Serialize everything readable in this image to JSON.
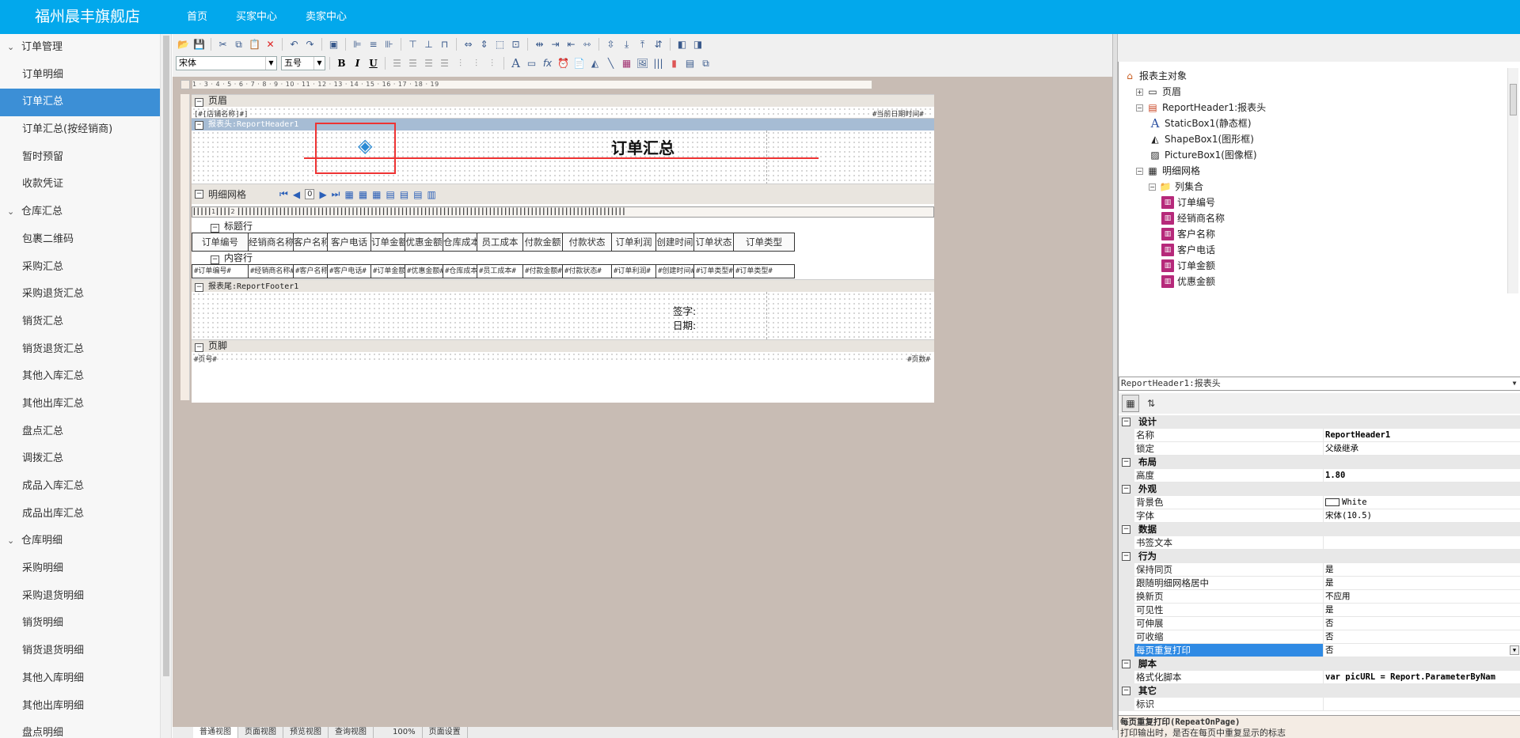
{
  "app": {
    "brand": "福州晨丰旗舰店",
    "nav": [
      "首页",
      "买家中心",
      "卖家中心"
    ]
  },
  "sidebar": [
    {
      "label": "订单管理",
      "type": "group"
    },
    {
      "label": "订单明细",
      "type": "sub"
    },
    {
      "label": "订单汇总",
      "type": "sub",
      "active": true
    },
    {
      "label": "订单汇总(按经销商)",
      "type": "sub"
    },
    {
      "label": "暂时预留",
      "type": "sub"
    },
    {
      "label": "收款凭证",
      "type": "sub"
    },
    {
      "label": "仓库汇总",
      "type": "group"
    },
    {
      "label": "包裹二维码",
      "type": "sub"
    },
    {
      "label": "采购汇总",
      "type": "sub"
    },
    {
      "label": "采购退货汇总",
      "type": "sub"
    },
    {
      "label": "销货汇总",
      "type": "sub"
    },
    {
      "label": "销货退货汇总",
      "type": "sub"
    },
    {
      "label": "其他入库汇总",
      "type": "sub"
    },
    {
      "label": "其他出库汇总",
      "type": "sub"
    },
    {
      "label": "盘点汇总",
      "type": "sub"
    },
    {
      "label": "调拨汇总",
      "type": "sub"
    },
    {
      "label": "成品入库汇总",
      "type": "sub"
    },
    {
      "label": "成品出库汇总",
      "type": "sub"
    },
    {
      "label": "仓库明细",
      "type": "group"
    },
    {
      "label": "采购明细",
      "type": "sub"
    },
    {
      "label": "采购退货明细",
      "type": "sub"
    },
    {
      "label": "销货明细",
      "type": "sub"
    },
    {
      "label": "销货退货明细",
      "type": "sub"
    },
    {
      "label": "其他入库明细",
      "type": "sub"
    },
    {
      "label": "其他出库明细",
      "type": "sub"
    },
    {
      "label": "盘点明细",
      "type": "sub"
    }
  ],
  "toolbar": {
    "font_name": "宋体",
    "font_size": "五号",
    "bold": "B",
    "italic": "I",
    "underline": "U"
  },
  "ruler_text": "1 · 3 · 4 · 5 · 6 · 7 · 8 · 9 · 10 · 11 · 12 · 13 · 14 · 15 · 16 · 17 · 18 · 19",
  "report": {
    "page_header": {
      "label": "页眉",
      "left_field": "[#[店铺名称]#]",
      "right_field": "#当前日期时间#"
    },
    "report_header": {
      "label": "报表头:ReportHeader1",
      "title": "订单汇总"
    },
    "detail_grid": {
      "label": "明细网格",
      "page_box": "0"
    },
    "title_row": {
      "label": "标题行"
    },
    "columns": [
      "订单编号",
      "经销商名称",
      "客户名称",
      "客户电话",
      "订单金额",
      "优惠金额",
      "仓库成本",
      "员工成本",
      "付款金额",
      "付款状态",
      "订单利润",
      "创建时间",
      "订单状态",
      "订单类型"
    ],
    "content_row": {
      "label": "内容行"
    },
    "cells": [
      "#订单编号#",
      "#经销商名称#",
      "#客户名称#",
      "#客户电话#",
      "#订单金额#",
      "#优惠金额#",
      "#仓库成本#",
      "#员工成本#",
      "#付款金额#",
      "#付款状态#",
      "#订单利润#",
      "#创建时间#",
      "#订单类型#",
      "#订单类型#"
    ],
    "report_footer": {
      "label": "报表尾:ReportFooter1",
      "sign": "签字:",
      "date": "日期:"
    },
    "page_footer": {
      "label": "页脚",
      "left_field": "#页号#",
      "right_field": "#页数#"
    }
  },
  "statusbar": [
    "普通视图",
    "页面视图",
    "预览视图",
    "查询视图",
    "100%",
    "页面设置"
  ],
  "tree": [
    {
      "label": "报表主对象",
      "level": 0,
      "icon": "home-icon"
    },
    {
      "label": "页眉",
      "level": 1,
      "icon": "page-icon",
      "expander": "+"
    },
    {
      "label": "ReportHeader1:报表头",
      "level": 1,
      "icon": "header-icon",
      "expander": "−"
    },
    {
      "label": "StaticBox1(静态框)",
      "level": 2,
      "icon": "text-a-icon"
    },
    {
      "label": "ShapeBox1(图形框)",
      "level": 2,
      "icon": "shape-icon"
    },
    {
      "label": "PictureBox1(图像框)",
      "level": 2,
      "icon": "picture-icon"
    },
    {
      "label": "明细网格",
      "level": 1,
      "icon": "grid-icon",
      "expander": "−"
    },
    {
      "label": "列集合",
      "level": 2,
      "icon": "folder-icon",
      "expander": "−"
    },
    {
      "label": "订单编号",
      "level": 3,
      "icon": "column-icon"
    },
    {
      "label": "经销商名称",
      "level": 3,
      "icon": "column-icon"
    },
    {
      "label": "客户名称",
      "level": 3,
      "icon": "column-icon"
    },
    {
      "label": "客户电话",
      "level": 3,
      "icon": "column-icon"
    },
    {
      "label": "订单金额",
      "level": 3,
      "icon": "column-icon"
    },
    {
      "label": "优惠金额",
      "level": 3,
      "icon": "column-icon"
    }
  ],
  "object_selector": "ReportHeader1:报表头",
  "properties": [
    {
      "cat": "设计"
    },
    {
      "name": "名称",
      "value": "ReportHeader1",
      "bold": true
    },
    {
      "name": "锁定",
      "value": "父级继承"
    },
    {
      "cat": "布局"
    },
    {
      "name": "高度",
      "value": "1.80",
      "bold": true
    },
    {
      "cat": "外观"
    },
    {
      "name": "背景色",
      "value": "White",
      "swatch": true
    },
    {
      "name": "字体",
      "value": "宋体(10.5)"
    },
    {
      "cat": "数据"
    },
    {
      "name": "书签文本",
      "value": ""
    },
    {
      "cat": "行为"
    },
    {
      "name": "保持同页",
      "value": "是"
    },
    {
      "name": "跟随明细网格居中",
      "value": "是"
    },
    {
      "name": "换新页",
      "value": "不应用"
    },
    {
      "name": "可见性",
      "value": "是"
    },
    {
      "name": "可伸展",
      "value": "否"
    },
    {
      "name": "可收缩",
      "value": "否"
    },
    {
      "name": "每页重复打印",
      "value": "否",
      "selected": true
    },
    {
      "cat": "脚本"
    },
    {
      "name": "格式化脚本",
      "value": "var picURL = Report.ParameterByNam",
      "bold": true
    },
    {
      "cat": "其它"
    },
    {
      "name": "标识",
      "value": ""
    }
  ],
  "prop_desc": {
    "title": "每页重复打印(RepeatOnPage)",
    "text": "打印输出时，是否在每页中重复显示的标志"
  }
}
